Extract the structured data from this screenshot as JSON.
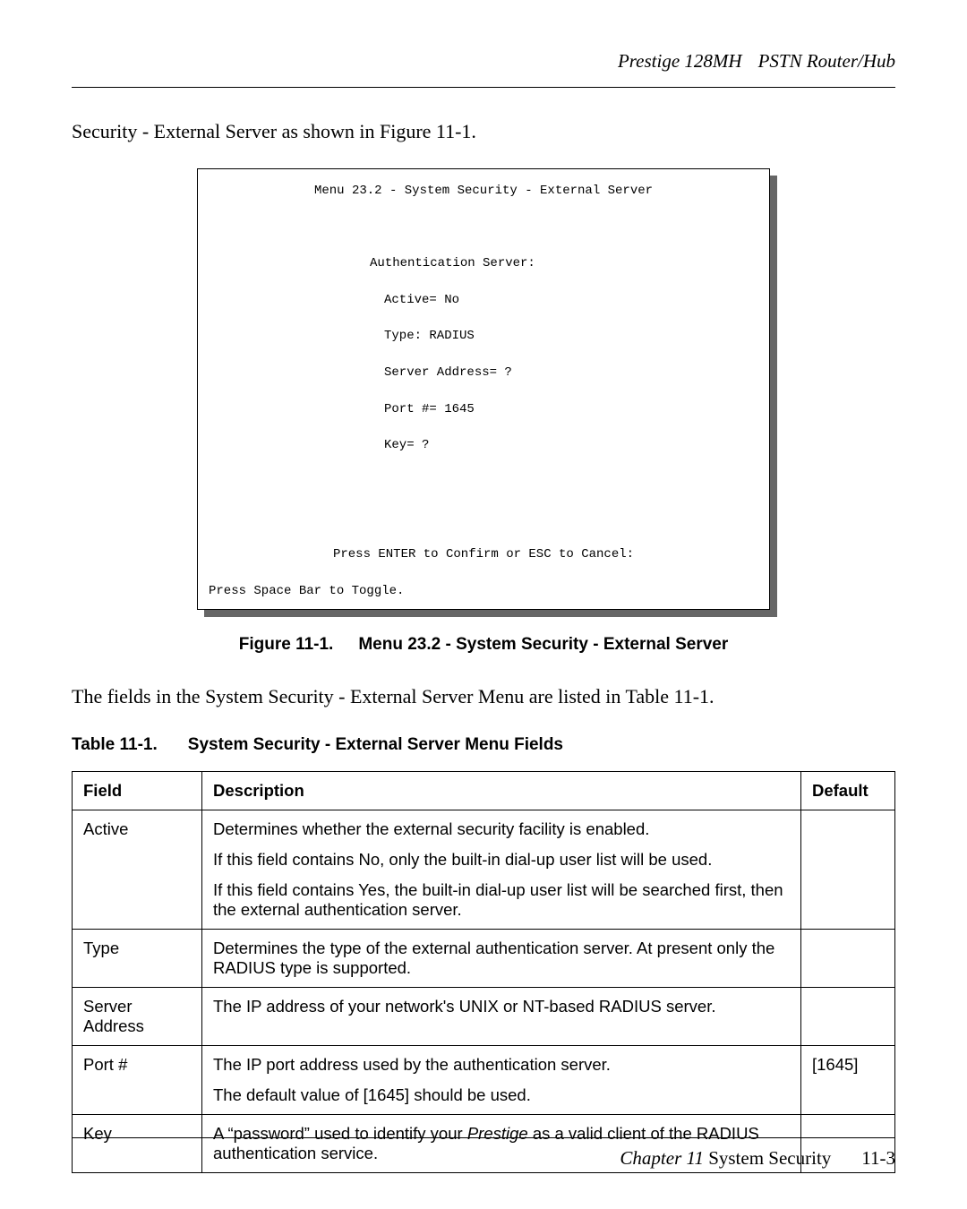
{
  "header": {
    "product": "Prestige 128MH",
    "subtitle": "PSTN Router/Hub"
  },
  "intro_line": "Security - External Server as shown in Figure 11-1.",
  "terminal": {
    "title": "Menu 23.2 - System Security - External Server",
    "section": "Authentication Server:",
    "l_active": "Active= No",
    "l_type": "Type: RADIUS",
    "l_addr": "Server Address= ?",
    "l_port": "Port #= 1645",
    "l_key": "Key= ?",
    "confirm": "Press ENTER to Confirm or ESC to Cancel:",
    "toggle": "Press Space Bar to Toggle."
  },
  "figure": {
    "num": "Figure 11-1.",
    "title": "Menu 23.2 - System Security - External Server"
  },
  "para2": "The fields in the System Security - External Server Menu are listed in Table 11-1.",
  "table_caption": {
    "num": "Table 11-1.",
    "title": "System Security - External Server Menu Fields"
  },
  "table": {
    "head": {
      "field": "Field",
      "desc": "Description",
      "def": "Default"
    },
    "rows": [
      {
        "field": "Active",
        "desc": [
          "Determines whether the external security facility is enabled.",
          "If this field contains No, only the built-in dial-up user list will be used.",
          "If this field contains Yes, the built-in dial-up user list will be searched first, then the external authentication server."
        ],
        "def": ""
      },
      {
        "field": "Type",
        "desc": [
          "Determines the type of the external authentication server. At present only the RADIUS type is supported."
        ],
        "def": ""
      },
      {
        "field": "Server Address",
        "desc": [
          "The IP address of your network's UNIX or NT-based RADIUS server."
        ],
        "def": ""
      },
      {
        "field": "Port #",
        "desc": [
          "The IP port address used by the authentication server.",
          "The default value of [1645] should be used."
        ],
        "def": "[1645]"
      },
      {
        "field": "Key",
        "desc_html": "key",
        "desc": [
          "A \"password\" used to identify your Prestige as a valid client of the RADIUS authentication service."
        ],
        "def": ""
      }
    ]
  },
  "key_row": {
    "pre": "A “password” used to identify your ",
    "em": "Prestige",
    "post": " as a valid client of the RADIUS authentication service."
  },
  "footer": {
    "chapter": "Chapter 11",
    "title": "System Security",
    "page": "11-3"
  }
}
